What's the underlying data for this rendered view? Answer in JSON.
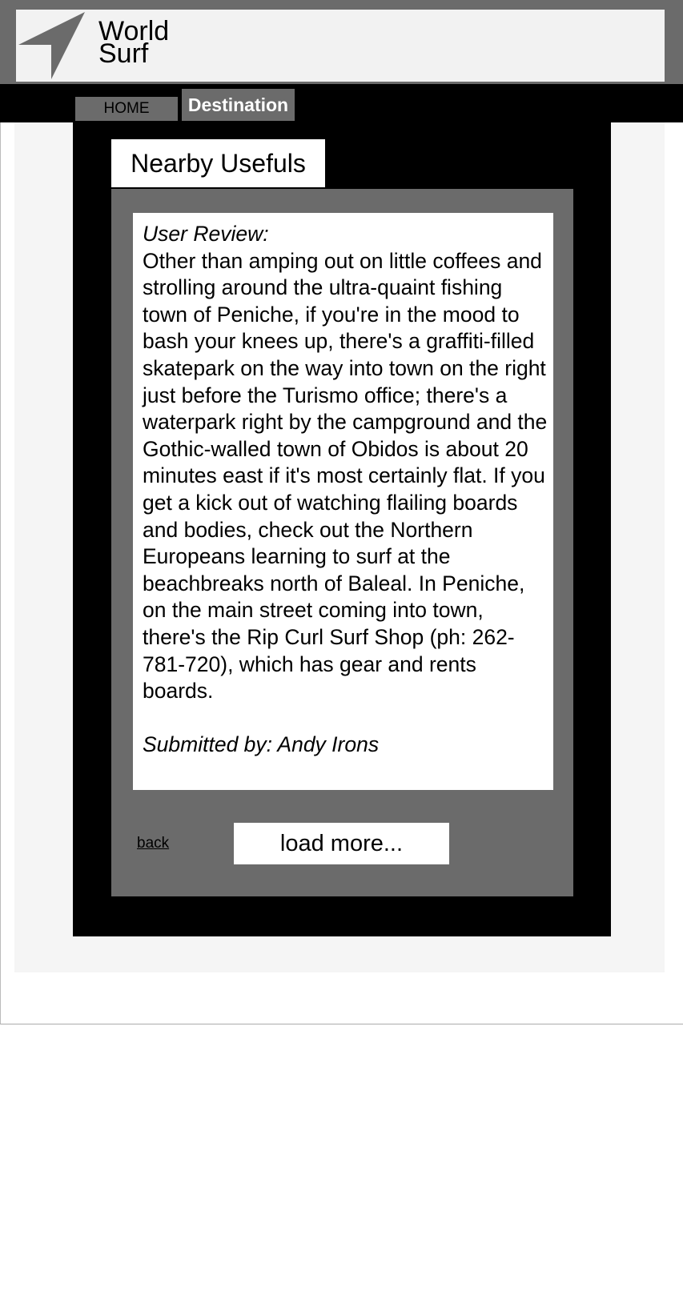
{
  "header": {
    "logo_icon": "navigation-arrow-icon",
    "logo_line1": "World",
    "logo_line2": "Surf"
  },
  "nav": {
    "home_label": "HOME",
    "destination_label": "Destination",
    "active": "Destination"
  },
  "section": {
    "title": "Nearby Usefuls"
  },
  "review": {
    "heading": "User Review:",
    "body": "Other than amping out on little coffees and strolling around the ultra-quaint fishing town of Peniche, if you're in the mood to bash your knees up, there's a graffiti-filled skatepark on the way into town on the right just before the Turismo office; there's a waterpark right by the campground and the Gothic-walled town of Obidos is about 20 minutes east if it's most certainly flat. If you get a kick out of watching flailing boards and bodies, check out the Northern Europeans learning to surf at the beachbreaks north of Baleal. In Peniche, on the main street coming into town, there's the Rip Curl Surf Shop (ph: 262-781-720), which has gear and rents boards.",
    "author_line": "Submitted by: Andy Irons"
  },
  "controls": {
    "back_label": "back",
    "load_more_label": "load more..."
  },
  "colors": {
    "header_gray": "#6b6b6b",
    "header_panel": "#f2f2f2",
    "nav_black": "#000000",
    "content_gray": "#6b6b6b",
    "page_background": "#f5f5f5"
  }
}
